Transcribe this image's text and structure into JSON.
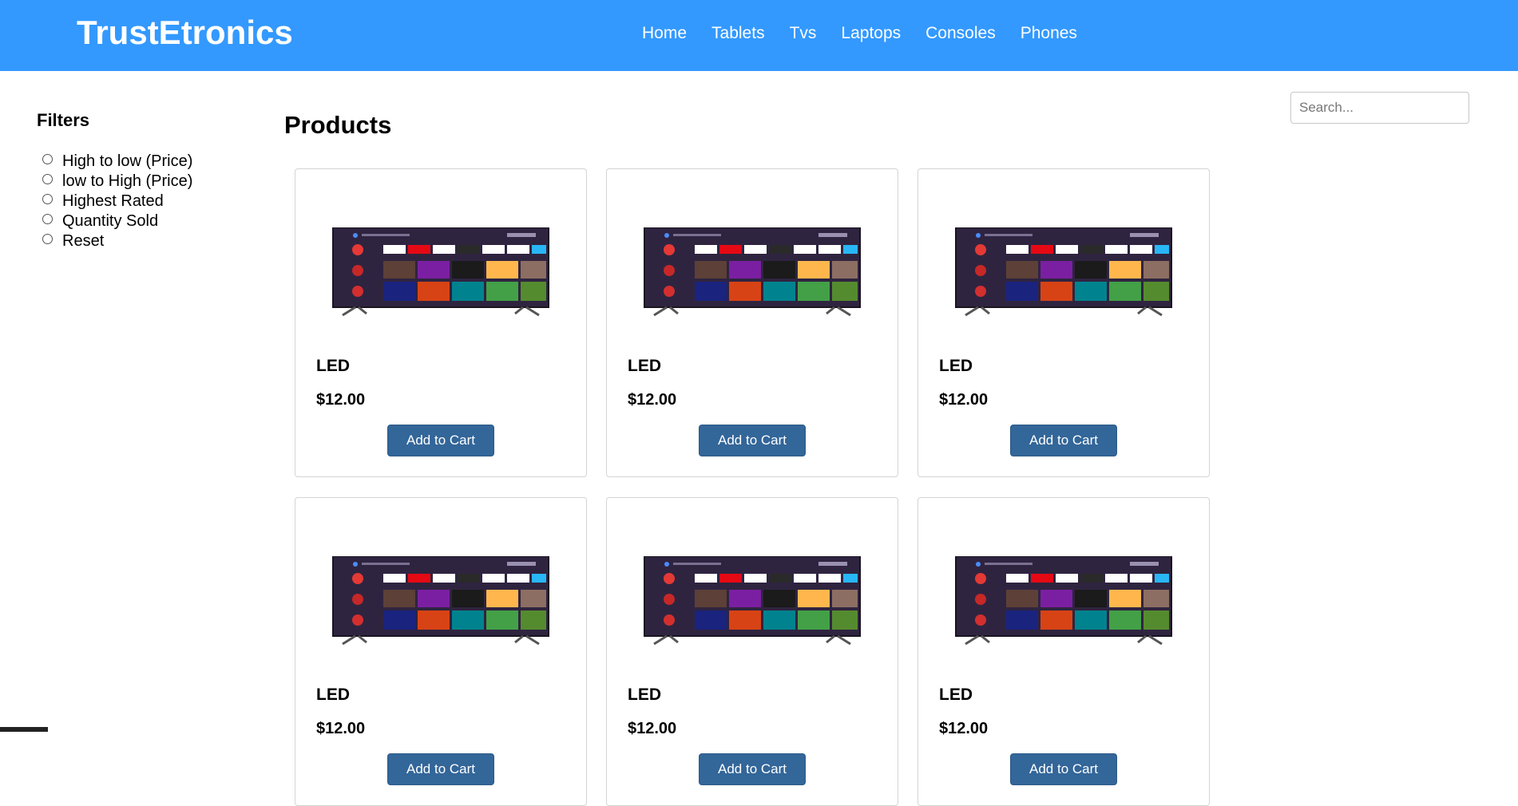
{
  "brand": "TrustEtronics",
  "nav": [
    "Home",
    "Tablets",
    "Tvs",
    "Laptops",
    "Consoles",
    "Phones"
  ],
  "search": {
    "placeholder": "Search..."
  },
  "filters": {
    "title": "Filters",
    "options": [
      "High to low (Price)",
      "low to High (Price)",
      "Highest Rated",
      "Quantity Sold",
      "Reset"
    ]
  },
  "products": {
    "title": "Products",
    "items": [
      {
        "name": "LED",
        "price": "$12.00",
        "button": "Add to Cart"
      },
      {
        "name": "LED",
        "price": "$12.00",
        "button": "Add to Cart"
      },
      {
        "name": "LED",
        "price": "$12.00",
        "button": "Add to Cart"
      },
      {
        "name": "LED",
        "price": "$12.00",
        "button": "Add to Cart"
      },
      {
        "name": "LED",
        "price": "$12.00",
        "button": "Add to Cart"
      },
      {
        "name": "LED",
        "price": "$12.00",
        "button": "Add to Cart"
      }
    ]
  },
  "colors": {
    "navbar": "#3399ff",
    "button": "#336699",
    "card_border": "#d4d4d4"
  },
  "icons": {
    "product_image": "tv-image"
  }
}
